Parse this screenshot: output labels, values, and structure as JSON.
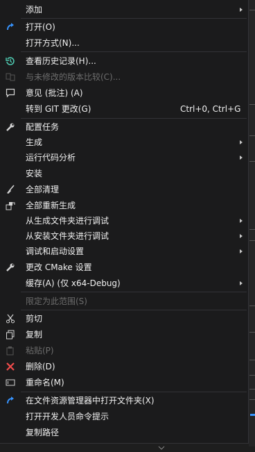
{
  "menu": {
    "items": [
      {
        "label": "添加",
        "submenu": true
      },
      {
        "label": "打开(O)",
        "icon": "redo-arrow-icon"
      },
      {
        "label": "打开方式(N)..."
      },
      {
        "label": "查看历史记录(H)...",
        "icon": "history-icon"
      },
      {
        "label": "与未修改的版本比较(C)...",
        "icon": "compare-icon",
        "disabled": true
      },
      {
        "label": "意见 (批注) (A)",
        "icon": "comment-icon"
      },
      {
        "label": "转到 GIT 更改(G)",
        "shortcut": "Ctrl+0, Ctrl+G"
      },
      {
        "label": "配置任务",
        "icon": "wrench-icon"
      },
      {
        "label": "生成",
        "submenu": true
      },
      {
        "label": "运行代码分析",
        "submenu": true
      },
      {
        "label": "安装"
      },
      {
        "label": "全部清理",
        "icon": "broom-icon"
      },
      {
        "label": "全部重新生成",
        "icon": "rebuild-icon"
      },
      {
        "label": "从生成文件夹进行调试",
        "submenu": true
      },
      {
        "label": "从安装文件夹进行调试",
        "submenu": true
      },
      {
        "label": "调试和启动设置",
        "submenu": true
      },
      {
        "label": "更改 CMake 设置",
        "icon": "wrench-icon"
      },
      {
        "label": "缓存(A) (仅 x64-Debug)",
        "submenu": true
      },
      {
        "label": "限定为此范围(S)",
        "disabled": true
      },
      {
        "label": "剪切",
        "icon": "scissors-icon"
      },
      {
        "label": "复制",
        "icon": "copy-icon"
      },
      {
        "label": "粘贴(P)",
        "icon": "paste-icon",
        "disabled": true
      },
      {
        "label": "删除(D)",
        "icon": "delete-x-icon"
      },
      {
        "label": "重命名(M)",
        "icon": "rename-icon"
      },
      {
        "label": "在文件资源管理器中打开文件夹(X)",
        "icon": "redo-arrow-icon"
      },
      {
        "label": "打开开发人员命令提示"
      },
      {
        "label": "复制路径"
      }
    ]
  },
  "colors": {
    "background": "#1b1b1c",
    "text": "#f1f1f1",
    "disabled_text": "#6d6d6d",
    "separator": "#333337",
    "icon_blue": "#3794ff",
    "icon_green": "#4ec9b0",
    "icon_red": "#f14c4c"
  }
}
